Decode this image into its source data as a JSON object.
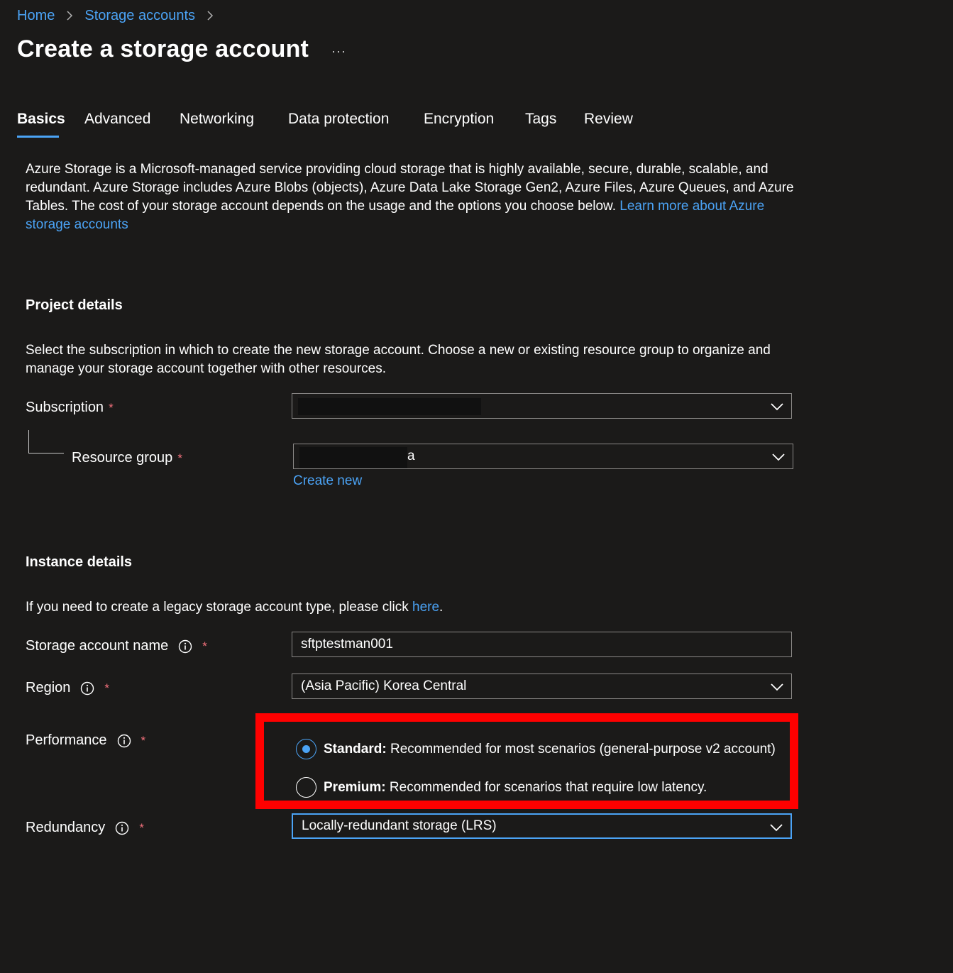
{
  "breadcrumb": {
    "home": "Home",
    "storage_accounts": "Storage accounts"
  },
  "header": {
    "title": "Create a storage account",
    "more": "···"
  },
  "tabs": [
    {
      "label": "Basics",
      "active": true
    },
    {
      "label": "Advanced"
    },
    {
      "label": "Networking"
    },
    {
      "label": "Data protection"
    },
    {
      "label": "Encryption"
    },
    {
      "label": "Tags"
    },
    {
      "label": "Review"
    }
  ],
  "intro": {
    "text": "Azure Storage is a Microsoft-managed service providing cloud storage that is highly available, secure, durable, scalable, and redundant. Azure Storage includes Azure Blobs (objects), Azure Data Lake Storage Gen2, Azure Files, Azure Queues, and Azure Tables. The cost of your storage account depends on the usage and the options you choose below.",
    "link": "Learn more about Azure storage accounts"
  },
  "project": {
    "title": "Project details",
    "description": "Select the subscription in which to create the new storage account. Choose a new or existing resource group to organize and manage your storage account together with other resources.",
    "subscription_label": "Subscription",
    "subscription_value": "",
    "resource_group_label": "Resource group",
    "resource_group_value": "a",
    "create_new": "Create new",
    "required_mark": "*"
  },
  "instance": {
    "title": "Instance details",
    "legacy_text": "If you need to create a legacy storage account type, please click ",
    "legacy_link": "here",
    "legacy_end": ".",
    "name_label": "Storage account name",
    "name_value": "sftptestman001",
    "region_label": "Region",
    "region_value": "(Asia Pacific) Korea Central",
    "performance_label": "Performance",
    "performance_options": [
      {
        "bold": "Standard:",
        "text": " Recommended for most scenarios (general-purpose v2 account)",
        "selected": true
      },
      {
        "bold": "Premium:",
        "text": " Recommended for scenarios that require low latency.",
        "selected": false
      }
    ],
    "redundancy_label": "Redundancy",
    "redundancy_value": "Locally-redundant storage (LRS)"
  },
  "colors": {
    "background": "#1b1a19",
    "link": "#4ba3f5",
    "required": "#f1707b",
    "highlight": "#ff0000"
  },
  "icons": [
    "chevron-right-icon",
    "chevron-down-icon",
    "info-icon",
    "more-icon"
  ]
}
